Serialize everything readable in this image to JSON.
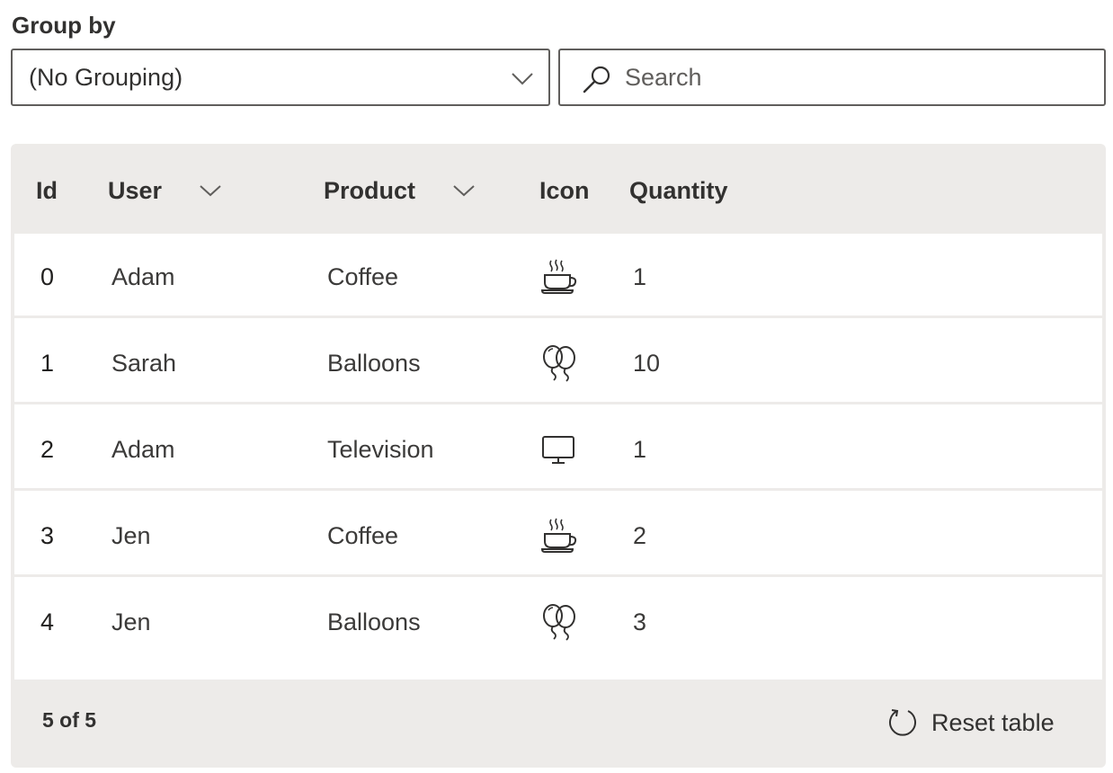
{
  "group_by": {
    "label": "Group by",
    "selected": "(No Grouping)"
  },
  "search": {
    "placeholder": "Search",
    "value": ""
  },
  "table": {
    "columns": {
      "id": "Id",
      "user": "User",
      "product": "Product",
      "icon": "Icon",
      "quantity": "Quantity"
    },
    "rows": [
      {
        "id": "0",
        "user": "Adam",
        "product": "Coffee",
        "icon": "coffee-icon",
        "quantity": "1"
      },
      {
        "id": "1",
        "user": "Sarah",
        "product": "Balloons",
        "icon": "balloons-icon",
        "quantity": "10"
      },
      {
        "id": "2",
        "user": "Adam",
        "product": "Television",
        "icon": "television-icon",
        "quantity": "1"
      },
      {
        "id": "3",
        "user": "Jen",
        "product": "Coffee",
        "icon": "coffee-icon",
        "quantity": "2"
      },
      {
        "id": "4",
        "user": "Jen",
        "product": "Balloons",
        "icon": "balloons-icon",
        "quantity": "3"
      }
    ]
  },
  "footer": {
    "count": "5 of 5",
    "reset_label": "Reset table"
  },
  "colors": {
    "table_background": "#edebe9",
    "text": "#323130",
    "border": "#605e5c"
  }
}
